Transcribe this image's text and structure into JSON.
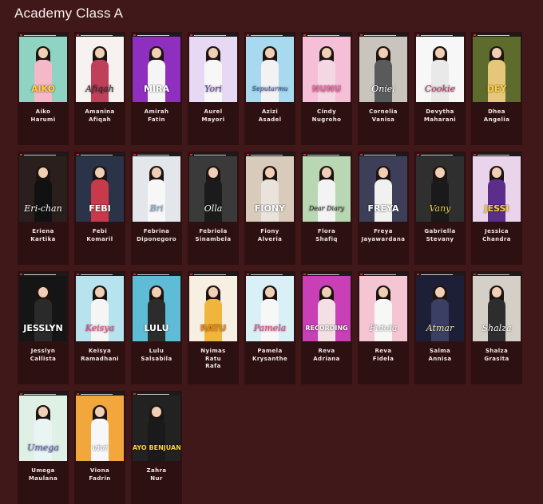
{
  "page": {
    "title": "Academy Class A"
  },
  "colors": {
    "background": "#411819",
    "card": "#2d1011",
    "text": "#ffffff"
  },
  "members": [
    {
      "name": [
        "Aiko",
        "Harumi"
      ],
      "poster": "AIKO",
      "bg": "#8fd3c3",
      "outfit": "#f4b8c8",
      "cap": "#ffd23c"
    },
    {
      "name": [
        "Amanina",
        "Afiqah"
      ],
      "poster": "Afiqah",
      "bg": "#f7f2ef",
      "outfit": "#c03f5a",
      "cap": "#2d2d2d"
    },
    {
      "name": [
        "Amirah",
        "Fatin"
      ],
      "poster": "MIRA",
      "bg": "#8f2fc0",
      "outfit": "#f5f5f5",
      "cap": "#ffffff"
    },
    {
      "name": [
        "Aurel",
        "Mayori"
      ],
      "poster": "Yori",
      "bg": "#e7d9f3",
      "outfit": "#f7f7f7",
      "cap": "#6b3fb0"
    },
    {
      "name": [
        "Azizi",
        "Asadel"
      ],
      "poster": "Seputarmu",
      "bg": "#a8d9ef",
      "outfit": "#f2f2f2",
      "cap": "#3a5aa8"
    },
    {
      "name": [
        "Cindy",
        "Nugroho"
      ],
      "poster": "NUNU",
      "bg": "#f6bfd8",
      "outfit": "#f5d7e4",
      "cap": "#f06aa4"
    },
    {
      "name": [
        "Cornelia",
        "Vanisa"
      ],
      "poster": "Oniel",
      "bg": "#c9c4be",
      "outfit": "#5a5a5a",
      "cap": "#ffffff"
    },
    {
      "name": [
        "Devytha",
        "Maharani"
      ],
      "poster": "Cookie",
      "bg": "#f7f7f7",
      "outfit": "#e9e9e9",
      "cap": "#c8336b"
    },
    {
      "name": [
        "Dhea",
        "Angelia"
      ],
      "poster": "DEY",
      "bg": "#5d6b2d",
      "outfit": "#e6c77a",
      "cap": "#ffd23c"
    },
    {
      "name": [
        "Eriena",
        "Kartika"
      ],
      "poster": "Eri-chan",
      "bg": "#2b1f1d",
      "outfit": "#111111",
      "cap": "#ffffff"
    },
    {
      "name": [
        "Febi",
        "Komaril"
      ],
      "poster": "FEBI",
      "bg": "#2a3348",
      "outfit": "#c83a4a",
      "cap": "#ffffff"
    },
    {
      "name": [
        "Febrina",
        "Diponegoro"
      ],
      "poster": "Bri",
      "bg": "#e3e6ea",
      "outfit": "#f7f7f7",
      "cap": "#7aa8d6"
    },
    {
      "name": [
        "Febriola",
        "Sinambela"
      ],
      "poster": "Olla",
      "bg": "#3a3a3a",
      "outfit": "#1b1b1b",
      "cap": "#ffffff"
    },
    {
      "name": [
        "Fiony",
        "Alveria"
      ],
      "poster": "FIONY",
      "bg": "#d8cbbb",
      "outfit": "#e9e3db",
      "cap": "#ffffff"
    },
    {
      "name": [
        "Flora",
        "Shafiq"
      ],
      "poster": "Dear Diary",
      "bg": "#b9d7b3",
      "outfit": "#f3f3f3",
      "cap": "#333333"
    },
    {
      "name": [
        "Freya",
        "Jayawardana"
      ],
      "poster": "FREYA",
      "bg": "#3c3f57",
      "outfit": "#f1f1f1",
      "cap": "#ffffff"
    },
    {
      "name": [
        "Gabriella",
        "Stevany"
      ],
      "poster": "Vany",
      "bg": "#2f2f2f",
      "outfit": "#1a1a1a",
      "cap": "#f2d24a"
    },
    {
      "name": [
        "Jessica",
        "Chandra"
      ],
      "poster": "JESSI",
      "bg": "#e9d4ec",
      "outfit": "#5b2e8c",
      "cap": "#ffd23c"
    },
    {
      "name": [
        "Jesslyn",
        "Callista"
      ],
      "poster": "JESSLYN",
      "bg": "#151515",
      "outfit": "#2a2a2a",
      "cap": "#ffffff"
    },
    {
      "name": [
        "Keisya",
        "Ramadhani"
      ],
      "poster": "Keisya",
      "bg": "#b6e3ee",
      "outfit": "#f5f5f5",
      "cap": "#e24b86"
    },
    {
      "name": [
        "Lulu",
        "Salsabila"
      ],
      "poster": "LULU",
      "bg": "#5fbcd6",
      "outfit": "#2c2c2c",
      "cap": "#ffffff"
    },
    {
      "name": [
        "Nyimas",
        "Ratu",
        "Rafa"
      ],
      "poster": "RATU",
      "bg": "#f7efe2",
      "outfit": "#f0b53c",
      "cap": "#f08a1c"
    },
    {
      "name": [
        "Pamela",
        "Krysanthe"
      ],
      "poster": "Pamela",
      "bg": "#d9f0f6",
      "outfit": "#f7f7f7",
      "cap": "#e24b86"
    },
    {
      "name": [
        "Reva",
        "Adriana"
      ],
      "poster": "RECORDING",
      "bg": "#c83fb6",
      "outfit": "#f4dfe4",
      "cap": "#ffffff"
    },
    {
      "name": [
        "Reva",
        "Fidela"
      ],
      "poster": "Fidela",
      "bg": "#f4c6d3",
      "outfit": "#f7f7f7",
      "cap": "#ffffff"
    },
    {
      "name": [
        "Salma",
        "Annisa"
      ],
      "poster": "Atmar",
      "bg": "#1d1f36",
      "outfit": "#3a3f63",
      "cap": "#f2e6b8"
    },
    {
      "name": [
        "Shalza",
        "Grasita"
      ],
      "poster": "Shalza",
      "bg": "#d4cfc7",
      "outfit": "#2d2d2d",
      "cap": "#ffffff"
    },
    {
      "name": [
        "Umega",
        "Maulana"
      ],
      "poster": "Umega",
      "bg": "#dff0e5",
      "outfit": "#e9f5f2",
      "cap": "#5a63c0"
    },
    {
      "name": [
        "Viona",
        "Fadrin"
      ],
      "poster": "vivi",
      "bg": "#f1a73b",
      "outfit": "#f7f7f7",
      "cap": "#ffffff"
    },
    {
      "name": [
        "Zahra",
        "Nur"
      ],
      "poster": "AYO BENJUANG",
      "bg": "#222222",
      "outfit": "#1a1a1a",
      "cap": "#ffd23c"
    }
  ]
}
